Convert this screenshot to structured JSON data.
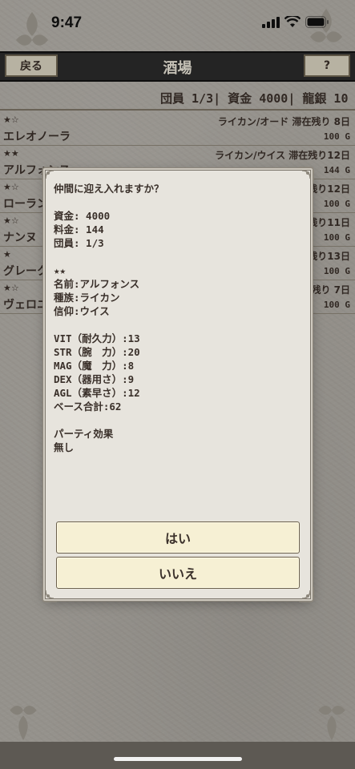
{
  "status_bar": {
    "time": "9:47"
  },
  "header": {
    "back_label": "戻る",
    "title": "酒場",
    "help_label": "?"
  },
  "resources": {
    "text": "団員 1/3| 資金 4000| 龍銀 10"
  },
  "recruits": [
    {
      "stars": "★☆",
      "name": "エレオノーラ",
      "info": "ライカン/オード 滞在残り 8日",
      "fee": "100 G"
    },
    {
      "stars": "★★",
      "name": "アルフォンス",
      "info": "ライカン/ウイス 滞在残り12日",
      "fee": "144 G"
    },
    {
      "stars": "★☆",
      "name": "ローラン",
      "info": "残り12日",
      "fee": "100 G"
    },
    {
      "stars": "★☆",
      "name": "ナンヌ",
      "info": "残り11日",
      "fee": "100 G"
    },
    {
      "stars": "★",
      "name": "グレーク",
      "info": "残り13日",
      "fee": "100 G"
    },
    {
      "stars": "★☆",
      "name": "ヴェロニ",
      "info": "残り 7日",
      "fee": "100 G"
    }
  ],
  "dialog": {
    "question": "仲間に迎え入れますか？",
    "funds": "資金: 4000",
    "fee": "料金: 144",
    "members": "団員: 1/3",
    "stars": "★★",
    "name": "名前:アルフォンス",
    "race": "種族:ライカン",
    "faith": "信仰:ウイス",
    "vit": "VIT（耐久力）:13",
    "str": "STR（腕　力）:20",
    "mag": "MAG（魔　力）:8",
    "dex": "DEX（器用さ）:9",
    "agl": "AGL（素早さ）:12",
    "base_total": "ベース合計:62",
    "party_effect_label": "パーティ効果",
    "party_effect_value": "無し",
    "yes_label": "はい",
    "no_label": "いいえ"
  },
  "colors": {
    "header_bg": "#2b2b2b",
    "button_bg": "#d8d2bf",
    "dialog_bg": "#e7e4dd",
    "dialog_button_bg": "#f6f0d4",
    "text": "#3a302a"
  }
}
